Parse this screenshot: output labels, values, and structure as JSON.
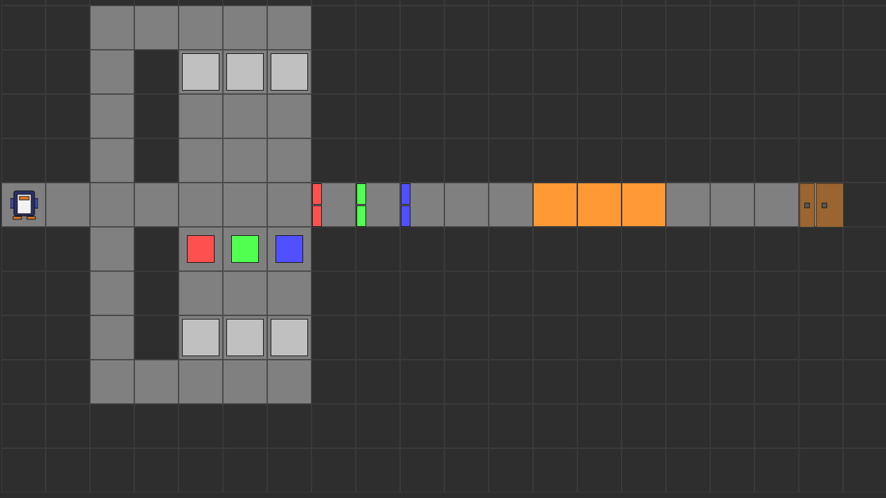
{
  "game": {
    "cols": 20,
    "rows": 12,
    "colors": {
      "background": "#2e2e2e",
      "floor": "#808080",
      "box": "#c0c0c0",
      "lava": "#ff9933",
      "door": "#9a6530",
      "red": "#ff5050",
      "green": "#50ff50",
      "blue": "#5050ff"
    },
    "floor_cells": [
      [
        2,
        1
      ],
      [
        3,
        1
      ],
      [
        4,
        1
      ],
      [
        5,
        1
      ],
      [
        6,
        1
      ],
      [
        2,
        2
      ],
      [
        4,
        2
      ],
      [
        5,
        2
      ],
      [
        6,
        2
      ],
      [
        2,
        3
      ],
      [
        4,
        3
      ],
      [
        5,
        3
      ],
      [
        6,
        3
      ],
      [
        2,
        4
      ],
      [
        4,
        4
      ],
      [
        5,
        4
      ],
      [
        6,
        4
      ],
      [
        0,
        5
      ],
      [
        1,
        5
      ],
      [
        2,
        5
      ],
      [
        3,
        5
      ],
      [
        4,
        5
      ],
      [
        5,
        5
      ],
      [
        6,
        5
      ],
      [
        7,
        5
      ],
      [
        8,
        5
      ],
      [
        9,
        5
      ],
      [
        10,
        5
      ],
      [
        11,
        5
      ],
      [
        12,
        5
      ],
      [
        13,
        5
      ],
      [
        14,
        5
      ],
      [
        15,
        5
      ],
      [
        16,
        5
      ],
      [
        17,
        5
      ],
      [
        18,
        5
      ],
      [
        2,
        6
      ],
      [
        4,
        6
      ],
      [
        5,
        6
      ],
      [
        6,
        6
      ],
      [
        2,
        7
      ],
      [
        4,
        7
      ],
      [
        5,
        7
      ],
      [
        6,
        7
      ],
      [
        2,
        8
      ],
      [
        4,
        8
      ],
      [
        5,
        8
      ],
      [
        6,
        8
      ],
      [
        2,
        9
      ],
      [
        3,
        9
      ],
      [
        4,
        9
      ],
      [
        5,
        9
      ],
      [
        6,
        9
      ]
    ],
    "lava_cells": [
      [
        12,
        5
      ],
      [
        13,
        5
      ],
      [
        14,
        5
      ]
    ],
    "boxes": [
      [
        4,
        2
      ],
      [
        5,
        2
      ],
      [
        6,
        2
      ],
      [
        4,
        8
      ],
      [
        5,
        8
      ],
      [
        6,
        8
      ]
    ],
    "keys": [
      {
        "cell": [
          4,
          6
        ],
        "color": "red"
      },
      {
        "cell": [
          5,
          6
        ],
        "color": "green"
      },
      {
        "cell": [
          6,
          6
        ],
        "color": "blue"
      }
    ],
    "gates": [
      {
        "cell": [
          7,
          5
        ],
        "color": "red"
      },
      {
        "cell": [
          8,
          5
        ],
        "color": "green"
      },
      {
        "cell": [
          9,
          5
        ],
        "color": "blue"
      }
    ],
    "door": {
      "cell": [
        18,
        5
      ],
      "icon": "door-icon"
    },
    "agent": {
      "cell": [
        0,
        5
      ],
      "icon": "penguin-icon"
    }
  }
}
